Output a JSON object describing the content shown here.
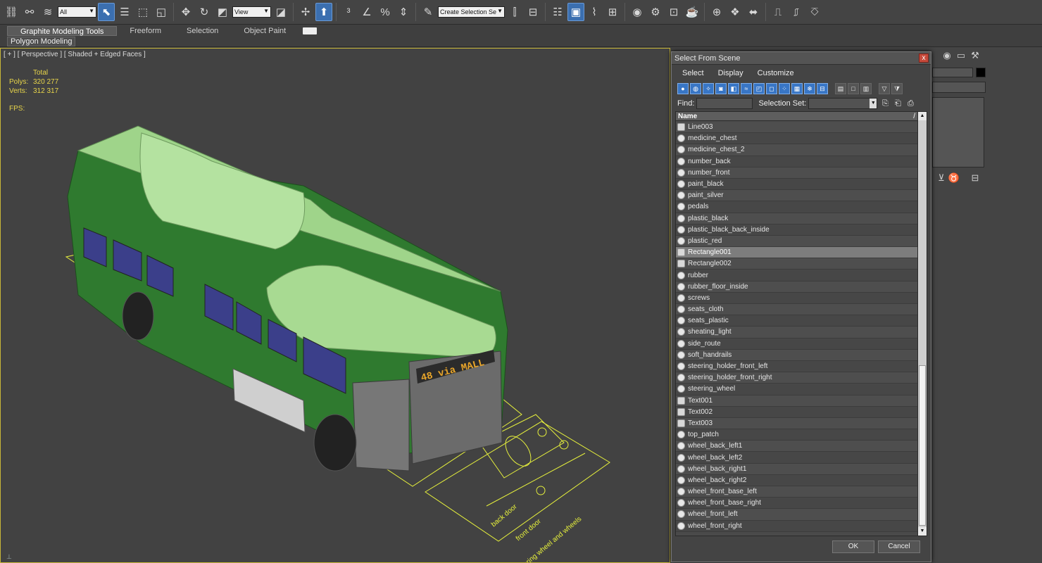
{
  "toolbar": {
    "selection_filter": "All",
    "reference_coord": "View",
    "named_selection_placeholder": "Create Selection Se"
  },
  "ribbon": {
    "tabs": [
      "Graphite Modeling Tools",
      "Freeform",
      "Selection",
      "Object Paint"
    ],
    "panel_label": "Polygon Modeling"
  },
  "viewport": {
    "label": "[ + ] [ Perspective ] [ Shaded + Edged Faces ]",
    "stats_header": "Total",
    "polys_label": "Polys:",
    "polys_value": "320 277",
    "verts_label": "Verts:",
    "verts_value": "312 317",
    "fps_label": "FPS:",
    "bus_sign": "48 via MALL",
    "floor_labels": [
      "back door",
      "front door",
      "steering wheel and wheels"
    ]
  },
  "dialog": {
    "title": "Select From Scene",
    "close_glyph": "x",
    "menu": [
      "Select",
      "Display",
      "Customize"
    ],
    "find_label": "Find:",
    "find_value": "",
    "selection_set_label": "Selection Set:",
    "column_name": "Name",
    "sort_glyph": "/",
    "items": [
      {
        "name": "Line003",
        "kind": "shape"
      },
      {
        "name": "medicine_chest",
        "kind": "geometry"
      },
      {
        "name": "medicine_chest_2",
        "kind": "geometry"
      },
      {
        "name": "number_back",
        "kind": "geometry"
      },
      {
        "name": "number_front",
        "kind": "geometry"
      },
      {
        "name": "paint_black",
        "kind": "geometry"
      },
      {
        "name": "paint_silver",
        "kind": "geometry"
      },
      {
        "name": "pedals",
        "kind": "geometry"
      },
      {
        "name": "plastic_black",
        "kind": "geometry"
      },
      {
        "name": "plastic_black_back_inside",
        "kind": "geometry"
      },
      {
        "name": "plastic_red",
        "kind": "geometry"
      },
      {
        "name": "Rectangle001",
        "kind": "shape",
        "selected": true
      },
      {
        "name": "Rectangle002",
        "kind": "shape"
      },
      {
        "name": "rubber",
        "kind": "geometry"
      },
      {
        "name": "rubber_floor_inside",
        "kind": "geometry"
      },
      {
        "name": "screws",
        "kind": "geometry"
      },
      {
        "name": "seats_cloth",
        "kind": "geometry"
      },
      {
        "name": "seats_plastic",
        "kind": "geometry"
      },
      {
        "name": "sheating_light",
        "kind": "geometry"
      },
      {
        "name": "side_route",
        "kind": "geometry"
      },
      {
        "name": "soft_handrails",
        "kind": "geometry"
      },
      {
        "name": "steering_holder_front_left",
        "kind": "geometry"
      },
      {
        "name": "steering_holder_front_right",
        "kind": "geometry"
      },
      {
        "name": "steering_wheel",
        "kind": "geometry"
      },
      {
        "name": "Text001",
        "kind": "shape"
      },
      {
        "name": "Text002",
        "kind": "shape"
      },
      {
        "name": "Text003",
        "kind": "shape"
      },
      {
        "name": "top_patch",
        "kind": "geometry"
      },
      {
        "name": "wheel_back_left1",
        "kind": "geometry"
      },
      {
        "name": "wheel_back_left2",
        "kind": "geometry"
      },
      {
        "name": "wheel_back_right1",
        "kind": "geometry"
      },
      {
        "name": "wheel_back_right2",
        "kind": "geometry"
      },
      {
        "name": "wheel_front_base_left",
        "kind": "geometry"
      },
      {
        "name": "wheel_front_base_right",
        "kind": "geometry"
      },
      {
        "name": "wheel_front_left",
        "kind": "geometry"
      },
      {
        "name": "wheel_front_right",
        "kind": "geometry"
      }
    ],
    "ok_label": "OK",
    "cancel_label": "Cancel"
  },
  "colors": {
    "bus_green": "#2f7a2f",
    "bus_top": "#9fd48a",
    "guide_yellow": "#e6f03c",
    "stats_yellow": "#e8d54a",
    "selection_blue": "#3876c6"
  }
}
